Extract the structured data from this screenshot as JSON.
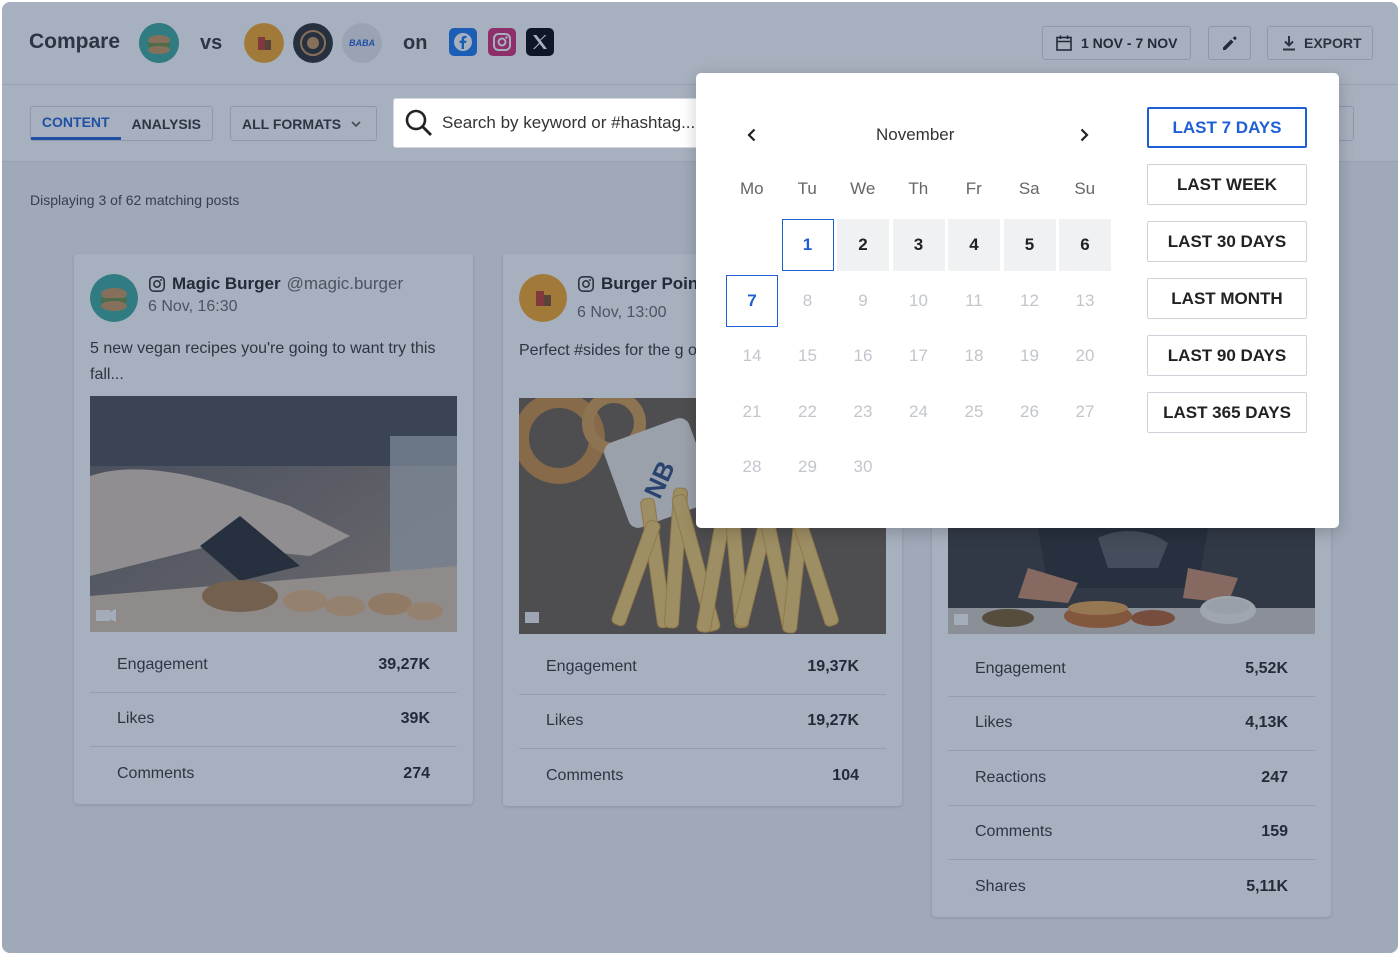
{
  "header": {
    "compare_label": "Compare",
    "vs_label": "vs",
    "on_label": "on",
    "date_range": "1 NOV - 7 NOV",
    "export_label": "EXPORT",
    "competitor_badge": "BABA"
  },
  "toolbar": {
    "tab_content": "CONTENT",
    "tab_analysis": "ANALYSIS",
    "formats_label": "ALL FORMATS",
    "search_placeholder": "Search by keyword or #hashtag..."
  },
  "displaying_text": "Displaying 3 of 62 matching posts",
  "posts": [
    {
      "name": "Magic Burger",
      "handle": "@magic.burger",
      "time": "6 Nov, 16:30",
      "text": "5 new vegan recipes you're going to want try this fall...",
      "metrics": [
        {
          "label": "Engagement",
          "value": "39,27K"
        },
        {
          "label": "Likes",
          "value": "39K"
        },
        {
          "label": "Comments",
          "value": "274"
        }
      ]
    },
    {
      "name": "Burger Point",
      "handle": "",
      "time": "6 Nov, 13:00",
      "text": "Perfect #sides for the g onion rings or...",
      "metrics": [
        {
          "label": "Engagement",
          "value": "19,37K"
        },
        {
          "label": "Likes",
          "value": "19,27K"
        },
        {
          "label": "Comments",
          "value": "104"
        }
      ]
    },
    {
      "name": "",
      "handle": "",
      "time": "",
      "text": "",
      "metrics": [
        {
          "label": "Engagement",
          "value": "5,52K"
        },
        {
          "label": "Likes",
          "value": "4,13K"
        },
        {
          "label": "Reactions",
          "value": "247"
        },
        {
          "label": "Comments",
          "value": "159"
        },
        {
          "label": "Shares",
          "value": "5,11K"
        }
      ]
    }
  ],
  "calendar": {
    "month": "November",
    "weekdays": [
      "Mo",
      "Tu",
      "We",
      "Th",
      "Fr",
      "Sa",
      "Su"
    ],
    "days": [
      "1",
      "2",
      "3",
      "4",
      "5",
      "6",
      "7",
      "8",
      "9",
      "10",
      "11",
      "12",
      "13",
      "14",
      "15",
      "16",
      "17",
      "18",
      "19",
      "20",
      "21",
      "22",
      "23",
      "24",
      "25",
      "26",
      "27",
      "28",
      "29",
      "30"
    ]
  },
  "presets": [
    "LAST 7 DAYS",
    "LAST WEEK",
    "LAST 30 DAYS",
    "LAST MONTH",
    "LAST 90 DAYS",
    "LAST 365 DAYS"
  ],
  "colors": {
    "accent": "#1f5fd6",
    "facebook": "#1877f2",
    "instagram": "#d62976",
    "x": "#000000"
  }
}
